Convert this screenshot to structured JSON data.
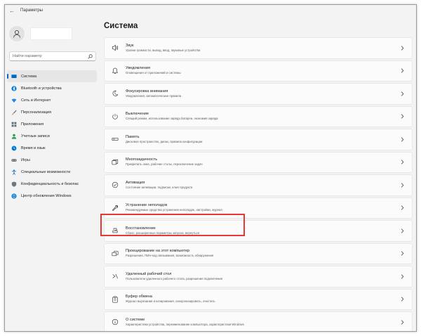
{
  "window": {
    "title": "Параметры",
    "back_glyph": "←"
  },
  "sidebar": {
    "search_placeholder": "Найти параметр",
    "items": [
      {
        "label": "Система",
        "icon": "system-display-icon",
        "color": "#0067c0",
        "active": true
      },
      {
        "label": "Bluetooth и устройства",
        "icon": "bluetooth-icon",
        "color": "#0078d4"
      },
      {
        "label": "Сеть и Интернет",
        "icon": "wifi-icon",
        "color": "#1e88e5"
      },
      {
        "label": "Персонализация",
        "icon": "brush-icon",
        "color": "#e07b39"
      },
      {
        "label": "Приложения",
        "icon": "apps-icon",
        "color": "#5a6a7a"
      },
      {
        "label": "Учетные записи",
        "icon": "accounts-icon",
        "color": "#2e9e4f"
      },
      {
        "label": "Время и язык",
        "icon": "globe-clock-icon",
        "color": "#0078d4"
      },
      {
        "label": "Игры",
        "icon": "gamepad-icon",
        "color": "#666666"
      },
      {
        "label": "Специальные возможности",
        "icon": "accessibility-icon",
        "color": "#0067c0"
      },
      {
        "label": "Конфиденциальность и безопас",
        "icon": "shield-icon",
        "color": "#6e7780"
      },
      {
        "label": "Центр обновления Windows",
        "icon": "windows-update-icon",
        "color": "#0078d4"
      }
    ]
  },
  "main": {
    "title": "Система",
    "chevron": "›",
    "rows": [
      {
        "title": "Звук",
        "subtitle": "Уровни громкости, вывод, ввод, звуковые устройства",
        "icon": "speaker-icon"
      },
      {
        "title": "Уведомления",
        "subtitle": "Оповещения от приложений и системы",
        "icon": "bell-icon"
      },
      {
        "title": "Фокусировка внимания",
        "subtitle": "Уведомления, автоматические правила",
        "icon": "moon-icon"
      },
      {
        "title": "Выключение",
        "subtitle": "Спящий режим, использование заряда батареи, экономия заряда",
        "icon": "power-icon"
      },
      {
        "title": "Память",
        "subtitle": "Дисковое пространство, диски, правила конфигурации",
        "icon": "storage-icon"
      },
      {
        "title": "Многозадачность",
        "subtitle": "Прикрепить окна, рабочие столы, переключение задач",
        "icon": "multitasking-icon"
      },
      {
        "title": "Активация",
        "subtitle": "Состояние активации, подписки, ключ продукта",
        "icon": "check-circle-icon"
      },
      {
        "title": "Устранение неполадок",
        "subtitle": "Рекомендуемые средства устранения неполадок, настройки, журнал",
        "icon": "wrench-icon"
      },
      {
        "title": "Восстановление",
        "subtitle": "Сброс, расширенные параметры запуска, вернуться",
        "icon": "recovery-icon"
      },
      {
        "title": "Проецирование на этот компьютер",
        "subtitle": "Разрешения, ПИН-код связывания, возможность обнаружения",
        "icon": "projection-icon"
      },
      {
        "title": "Удаленный рабочий стол",
        "subtitle": "Пользователи удаленного рабочего стола, разрешения подключения",
        "icon": "remote-desktop-icon"
      },
      {
        "title": "Буфер обмена",
        "subtitle": "Журнал вырезания и копирования, синхронизировать, очистить",
        "icon": "clipboard-icon"
      },
      {
        "title": "О системе",
        "subtitle": "Характеристики устройства, переименование компьютера, характеристики Windows",
        "icon": "info-icon"
      }
    ]
  },
  "highlight_color": "#e53935"
}
